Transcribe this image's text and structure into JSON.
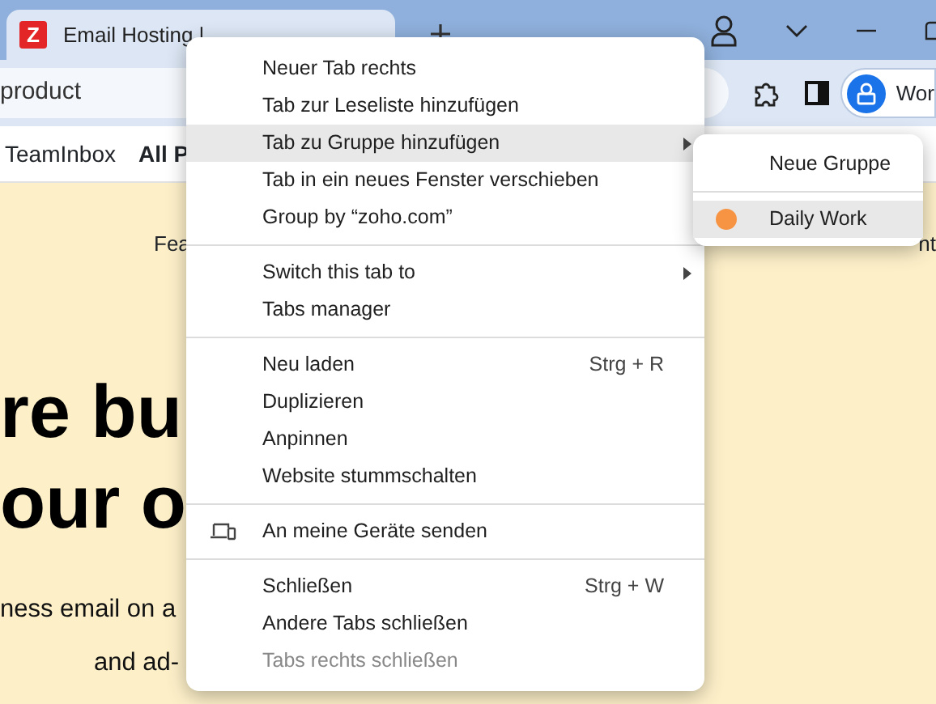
{
  "browser": {
    "tab": {
      "title": "Email Hosting |",
      "favicon": "Z"
    },
    "address": "product",
    "bookmarks": [
      "TeamInbox",
      "All P"
    ],
    "profile_label": "Wor"
  },
  "page": {
    "nav_left": "Fea",
    "nav_right": "nt",
    "headline": [
      "re bu",
      "our o"
    ],
    "body": [
      "ness email on a",
      "and ad-"
    ]
  },
  "menu": {
    "sections": [
      [
        {
          "label": "Neuer Tab rechts",
          "has_submenu": false,
          "highlighted": false,
          "disabled": false
        },
        {
          "label": "Tab zur Leseliste hinzufügen",
          "has_submenu": false,
          "highlighted": false,
          "disabled": false
        },
        {
          "label": "Tab zu Gruppe hinzufügen",
          "has_submenu": true,
          "highlighted": true,
          "disabled": false
        },
        {
          "label": "Tab in ein neues Fenster verschieben",
          "has_submenu": false,
          "highlighted": false,
          "disabled": false
        },
        {
          "label": "Group by “zoho.com”",
          "has_submenu": false,
          "highlighted": false,
          "disabled": false
        }
      ],
      [
        {
          "label": "Switch this tab to",
          "has_submenu": true,
          "highlighted": false,
          "disabled": false
        },
        {
          "label": "Tabs manager",
          "has_submenu": false,
          "highlighted": false,
          "disabled": false
        }
      ],
      [
        {
          "label": "Neu laden",
          "shortcut": "Strg + R",
          "has_submenu": false,
          "highlighted": false,
          "disabled": false
        },
        {
          "label": "Duplizieren",
          "has_submenu": false,
          "highlighted": false,
          "disabled": false
        },
        {
          "label": "Anpinnen",
          "has_submenu": false,
          "highlighted": false,
          "disabled": false
        },
        {
          "label": "Website stummschalten",
          "has_submenu": false,
          "highlighted": false,
          "disabled": false
        }
      ],
      [
        {
          "label": "An meine Geräte senden",
          "has_submenu": false,
          "highlighted": false,
          "disabled": false
        }
      ],
      [
        {
          "label": "Schließen",
          "shortcut": "Strg + W",
          "has_submenu": false,
          "highlighted": false,
          "disabled": false
        },
        {
          "label": "Andere Tabs schließen",
          "has_submenu": false,
          "highlighted": false,
          "disabled": false
        },
        {
          "label": "Tabs rechts schließen",
          "has_submenu": false,
          "highlighted": false,
          "disabled": true
        }
      ]
    ]
  },
  "submenu": {
    "sections": [
      [
        {
          "label": "Neue Gruppe",
          "highlighted": false
        }
      ],
      [
        {
          "label": "Daily Work",
          "color": "#f79443",
          "highlighted": true
        }
      ]
    ]
  }
}
